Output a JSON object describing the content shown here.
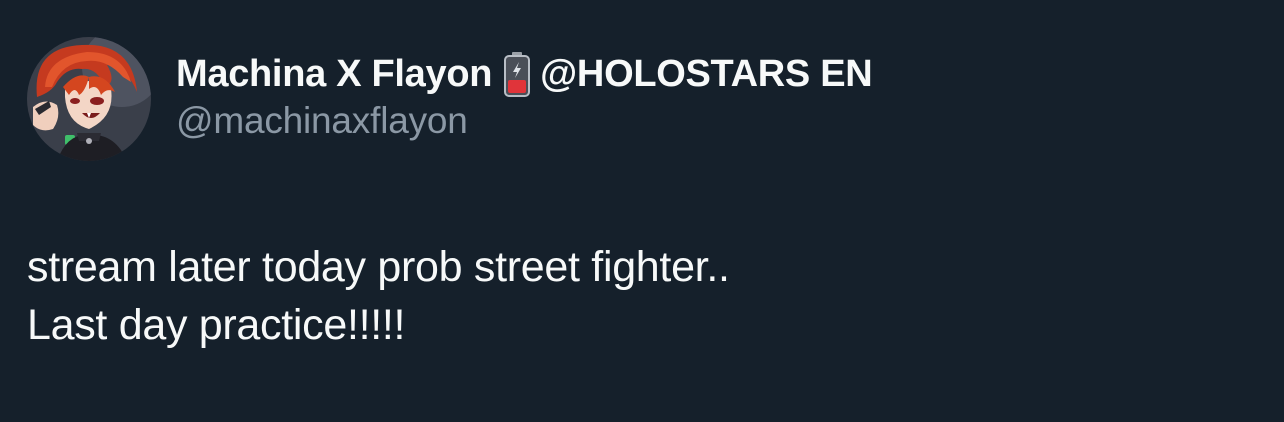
{
  "author": {
    "display_name": "Machina X Flayon",
    "emoji_icon": "low-battery-icon",
    "affiliation": "@HOLOSTARS EN",
    "handle": "@machinaxflayon",
    "avatar_icon": "avatar-anime-character-red-hair"
  },
  "tweet": {
    "lines": [
      "stream later today prob street fighter..",
      "Last day practice!!!!!"
    ]
  },
  "colors": {
    "background": "#15202b",
    "primary_text": "#f7f9f9",
    "secondary_text": "#8b98a5",
    "battery_red": "#e0343a"
  }
}
